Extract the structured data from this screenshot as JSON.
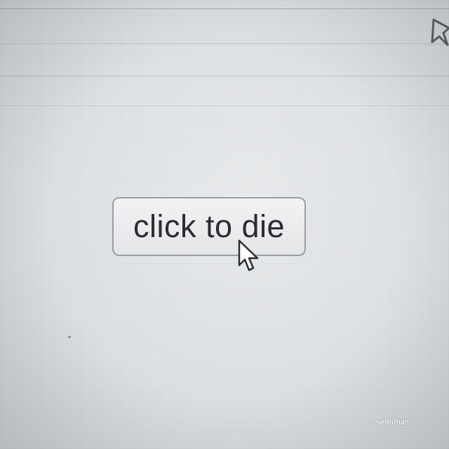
{
  "button": {
    "label": "click to die"
  },
  "icons": {
    "top_right": "navigation-arrow-icon",
    "pointer": "mouse-pointer-icon"
  },
  "watermark": {
    "text": "seteilhas"
  },
  "colors": {
    "background": "#e4e6e9",
    "button_border": "#9a9ea3",
    "button_text": "#2a2c30",
    "watermark_text": "#ffffff"
  }
}
